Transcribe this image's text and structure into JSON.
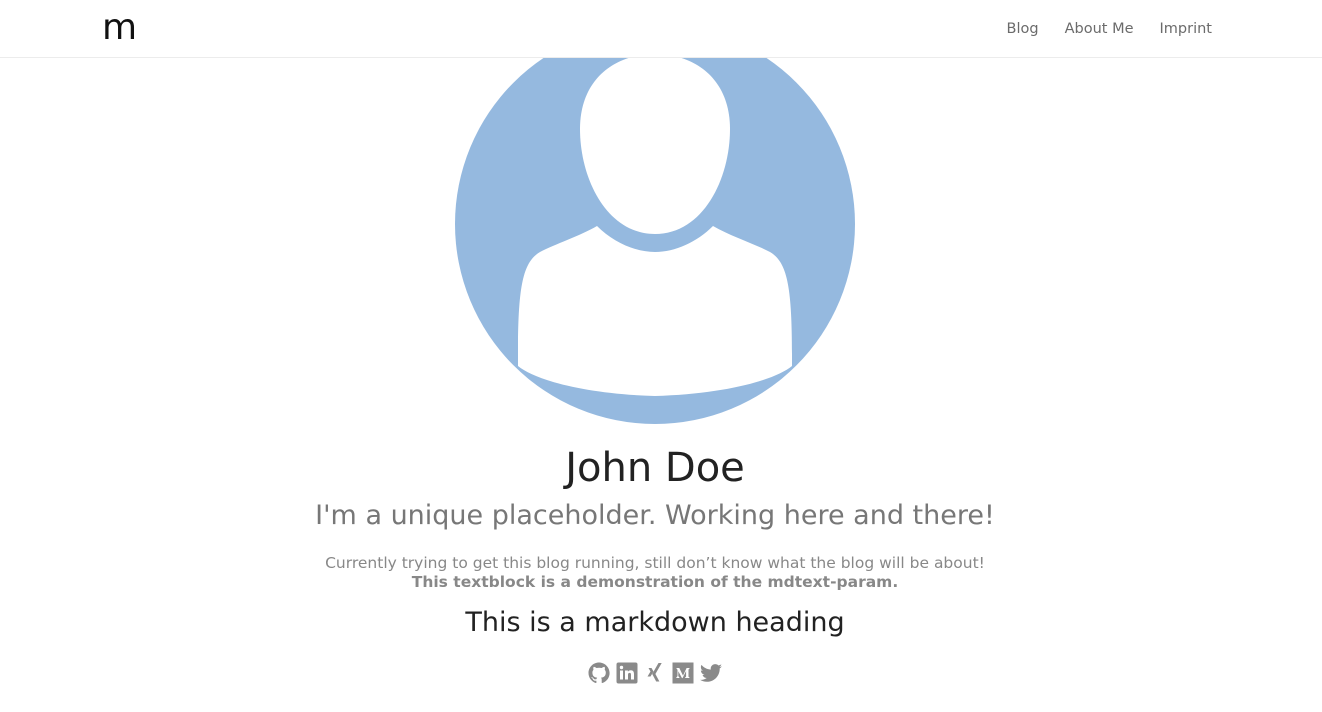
{
  "nav": {
    "logo": "m",
    "links": [
      "Blog",
      "About Me",
      "Imprint"
    ]
  },
  "profile": {
    "name": "John Doe",
    "tagline": "I'm a unique placeholder. Working here and there!",
    "mdtext_line1": "Currently trying to get this blog running, still don’t know what the blog will be about!",
    "mdtext_line2": "This textblock is a demonstration of the mdtext-param.",
    "md_heading": "This is a markdown heading"
  },
  "social": {
    "icons": [
      "github-icon",
      "linkedin-icon",
      "xing-icon",
      "medium-icon",
      "twitter-icon"
    ]
  },
  "colors": {
    "avatar_bg": "#95b9df",
    "icon": "#8a8a8a",
    "nav_text": "#6b6b6b"
  }
}
